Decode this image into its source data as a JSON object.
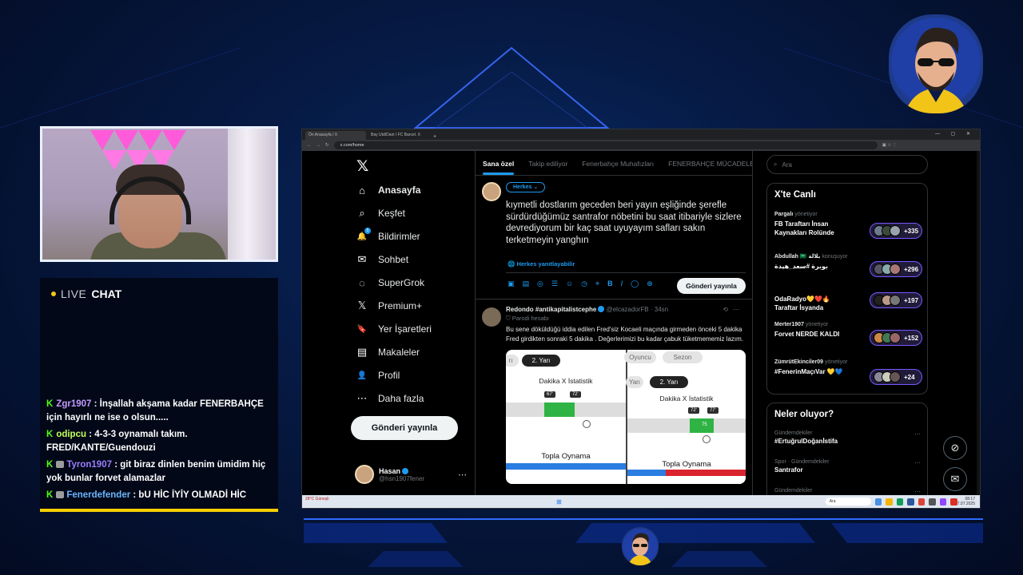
{
  "chat": {
    "live": "LIVE",
    "chat": "CHAT",
    "messages": [
      {
        "user": "Zgr1907",
        "text": ": İnşallah akşama kadar FENERBAHÇE için hayırlı ne ise o olsun....."
      },
      {
        "user": "odipcu",
        "text": ": 4-3-3 oynamalı takım. FRED/KANTE/Guendouzi"
      },
      {
        "user": "Tyron1907",
        "text": ": git biraz dinlen benim ümidim hiç yok bunlar forvet alamazlar"
      },
      {
        "user": "Fenerdefender",
        "text": ": bU HİC İYİY OLMADİ HİC"
      }
    ]
  },
  "browser": {
    "tabs": [
      "Ön Anasayfa / X",
      "Bay Utd/Dani / FC Barcel. X"
    ],
    "url": "x.com/home",
    "win_controls": "—  ▢  ✕"
  },
  "nav": {
    "items": [
      {
        "label": "Anasayfa",
        "icon": "home-icon",
        "glyph": "⌂"
      },
      {
        "label": "Keşfet",
        "icon": "search-icon",
        "glyph": "⌕"
      },
      {
        "label": "Bildirimler",
        "icon": "bell-icon",
        "glyph": "🔔"
      },
      {
        "label": "Sohbet",
        "icon": "mail-icon",
        "glyph": "✉"
      },
      {
        "label": "SuperGrok",
        "icon": "grok-icon",
        "glyph": "◌"
      },
      {
        "label": "Premium+",
        "icon": "x-premium-icon",
        "glyph": "𝕏"
      },
      {
        "label": "Yer İşaretleri",
        "icon": "bookmark-icon",
        "glyph": "🔖"
      },
      {
        "label": "Makaleler",
        "icon": "article-icon",
        "glyph": "▤"
      },
      {
        "label": "Profil",
        "icon": "profile-icon",
        "glyph": "👤"
      },
      {
        "label": "Daha fazla",
        "icon": "more-icon",
        "glyph": "⋯"
      }
    ],
    "notif_count": "5",
    "post_button": "Gönderi yayınla",
    "profile": {
      "name": "Hasan",
      "handle": "@hsn1907fener"
    }
  },
  "center": {
    "tabs": [
      "Sana özel",
      "Takip ediliyor",
      "Fenerbahçe Muhafızları",
      "FENERBAHÇE MÜCADELE"
    ],
    "compose": {
      "audience": "Herkes",
      "text": "kıymetli dostlarım geceden beri yayın eşliğinde şerefle sürdürdüğümüz santrafor nöbetini bu saat itibariyle sizlere devrediyorum bir kaç saat uyuyayım safları sakın terketmeyin yanghın",
      "reply_setting": "Herkes yanıtlayabilir",
      "send": "Gönderi yayınla"
    },
    "tweet": {
      "name": "Redondo #antikapitalistcephe",
      "handle": "@elcazadorFB",
      "time": "· 34sn",
      "parody": "Parodi hesabı",
      "body": "Bu sene döküldüğü iddia edilen Fred'siz Kocaeli maçında girmeden önceki 5 dakika Fred girdikten sonraki 5 dakika . Değerlerimizi bu kadar çabuk tüketmememiz lazım.",
      "media": {
        "p1": {
          "tab_left": "rı",
          "tab_active": "2. Yarı",
          "title": "Dakika X İstatistik",
          "min_a": "67'",
          "min_b": "72'",
          "footer": "Topla Oynama"
        },
        "p2": {
          "tab_a": "Oyuncu",
          "tab_b": "Sezon",
          "tab_left": "Yarı",
          "tab_active": "2. Yarı",
          "title": "Dakika X İstatistik",
          "min_a": "72'",
          "min_b": "77'",
          "marker": "75",
          "footer": "Topla Oynama"
        }
      }
    }
  },
  "right": {
    "search_placeholder": "Ara",
    "live_title": "X'te Canlı",
    "spaces": [
      {
        "host": "Pargalı",
        "role": "yönetiyor",
        "title": "FB Taraftarı İnsan Kaynakları Rolünde",
        "count": "+335"
      },
      {
        "host": "Abdullah 🇸🇦 بلالة",
        "role": "konuşuyor",
        "title": "بوبرة #سعد_هيدة",
        "count": "+296"
      },
      {
        "host": "",
        "role": "",
        "title": "OdaRadyo💛❤️🔥 Taraftar İsyanda",
        "count": "+197"
      },
      {
        "host": "Merter1907",
        "role": "yönetiyor",
        "title": "Forvet NERDE KALDI",
        "count": "+152"
      },
      {
        "host": "ZümrütEkinciler09",
        "role": "yönetiyor",
        "title": "#FenerinMaçıVar 💛💙",
        "count": "+24"
      }
    ],
    "trends_title": "Neler oluyor?",
    "trends": [
      {
        "category": "Gündemdekiler",
        "name": "#ErtuğrulDoğanİstifa"
      },
      {
        "category": "Spor · Gündemdekiler",
        "name": "Santrafor"
      },
      {
        "category": "Gündemdekiler",
        "name": ""
      }
    ]
  },
  "taskbar": {
    "weather": "28°C Güneşli",
    "search": "Ara",
    "time": "08:17",
    "date": "7.07.2025"
  },
  "colors": {
    "accent": "#1d9bf0",
    "kick_green": "#53fc18",
    "chat_bar": "#f5d000",
    "spaces_purple": "#7856ff"
  }
}
